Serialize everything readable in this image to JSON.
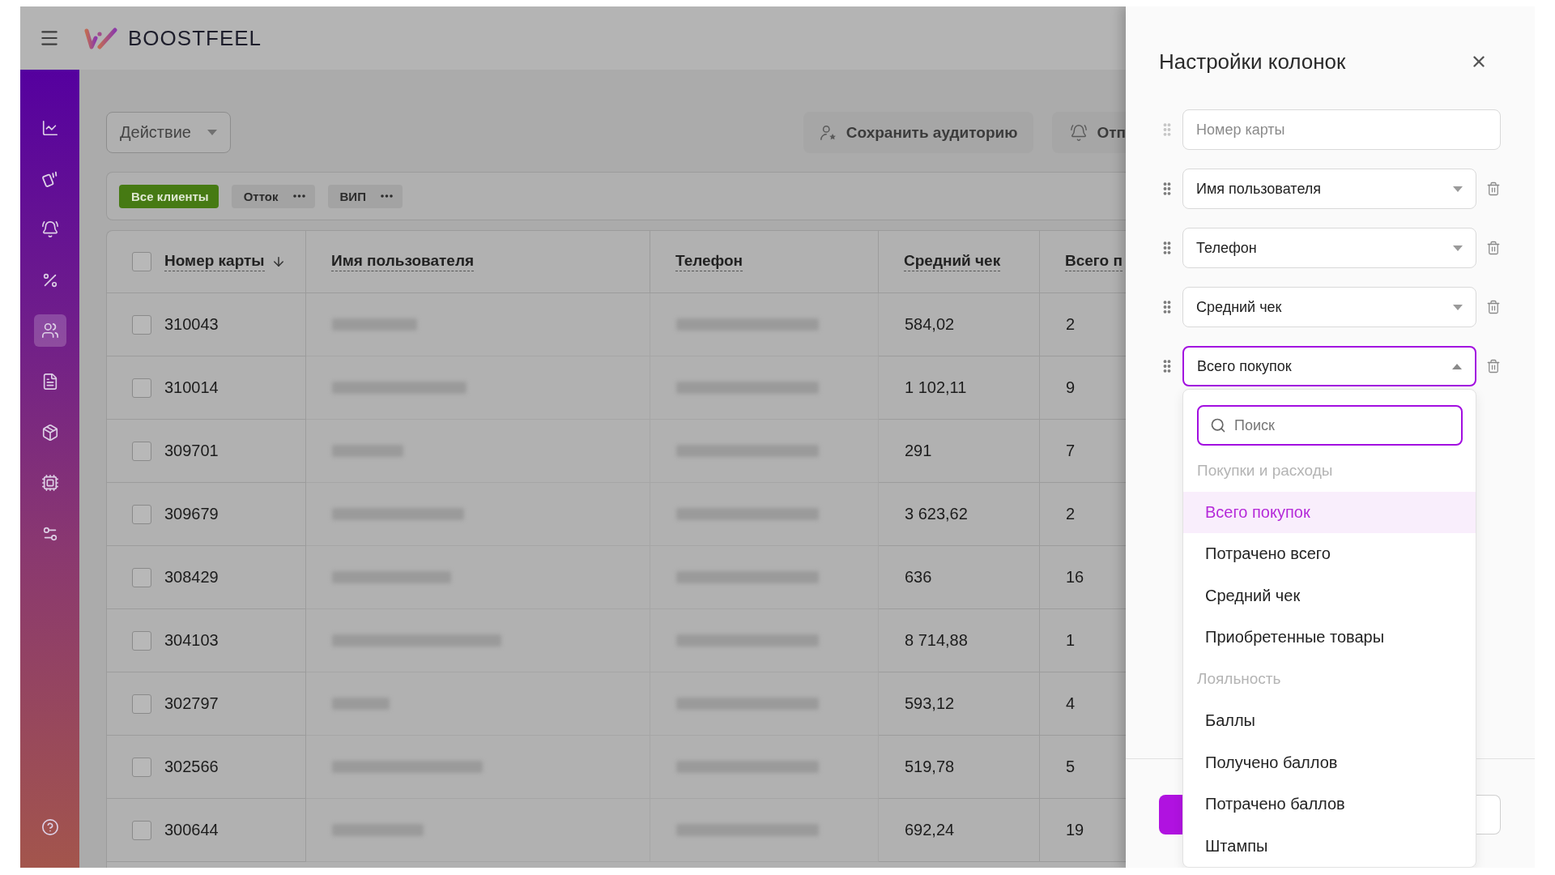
{
  "header": {
    "logo": "BOOSTFEEL"
  },
  "sidebar": {
    "items": [
      {
        "selected": false
      },
      {
        "selected": false
      },
      {
        "selected": false
      },
      {
        "selected": false
      },
      {
        "selected": true
      },
      {
        "selected": false
      },
      {
        "selected": false
      },
      {
        "selected": false
      },
      {
        "selected": false
      }
    ]
  },
  "toolbar": {
    "action": "Действие",
    "buttons": [
      {
        "label": "Сохранить аудиторию"
      },
      {
        "label": "Отп"
      }
    ]
  },
  "segments": [
    {
      "label": "Все клиенты",
      "kind": "system",
      "selected": true
    },
    {
      "label": "Отток",
      "kind": "custom",
      "selected": false
    },
    {
      "label": "ВИП",
      "kind": "custom",
      "selected": false
    }
  ],
  "table": {
    "header_checked": false,
    "columns": [
      {
        "label": "Номер карты",
        "sorted": true
      },
      {
        "label": "Имя пользователя",
        "sorted": false
      },
      {
        "label": "Телефон",
        "sorted": false
      },
      {
        "label": "Средний чек",
        "sorted": false
      },
      {
        "label": "Всего п",
        "sorted": false
      }
    ],
    "rows": [
      {
        "checked": false,
        "card_number": "310043",
        "average_check": "584,02",
        "column_5": "2"
      },
      {
        "checked": false,
        "card_number": "310014",
        "average_check": "1 102,11",
        "column_5": "9"
      },
      {
        "checked": false,
        "card_number": "309701",
        "average_check": "291",
        "column_5": "7"
      },
      {
        "checked": false,
        "card_number": "309679",
        "average_check": "3 623,62",
        "column_5": "2"
      },
      {
        "checked": false,
        "card_number": "308429",
        "average_check": "636",
        "column_5": "16"
      },
      {
        "checked": false,
        "card_number": "304103",
        "average_check": "8 714,88",
        "column_5": "1"
      },
      {
        "checked": false,
        "card_number": "302797",
        "average_check": "593,12",
        "column_5": "4"
      },
      {
        "checked": false,
        "card_number": "302566",
        "average_check": "519,78",
        "column_5": "5"
      },
      {
        "checked": false,
        "card_number": "300644",
        "average_check": "692,24",
        "column_5": "19"
      }
    ]
  },
  "panel": {
    "title": "Настройки колонок",
    "columns": [
      {
        "label": "Номер карты",
        "disabled": true,
        "expanded": false
      },
      {
        "label": "Имя пользователя",
        "disabled": false,
        "expanded": false
      },
      {
        "label": "Телефон",
        "disabled": false,
        "expanded": false
      },
      {
        "label": "Средний чек",
        "disabled": false,
        "expanded": false
      },
      {
        "label": "Всего покупок",
        "disabled": false,
        "expanded": true
      }
    ],
    "dropdown": {
      "search": {
        "placeholder": "Поиск"
      },
      "groups": [
        {
          "title": "Покупки и расходы",
          "options": [
            {
              "label": "Всего покупок",
              "selected": true
            },
            {
              "label": "Потрачено всего",
              "selected": false
            },
            {
              "label": "Средний чек",
              "selected": false
            },
            {
              "label": "Приобретенные товары",
              "selected": false
            }
          ]
        },
        {
          "title": "Лояльность",
          "options": [
            {
              "label": "Баллы",
              "selected": false
            },
            {
              "label": "Получено баллов",
              "selected": false
            },
            {
              "label": "Потрачено баллов",
              "selected": false
            },
            {
              "label": "Штампы",
              "selected": false
            }
          ]
        }
      ]
    },
    "footer_buttons": [
      {
        "kind": "primary"
      },
      {
        "kind": "outline"
      }
    ]
  }
}
